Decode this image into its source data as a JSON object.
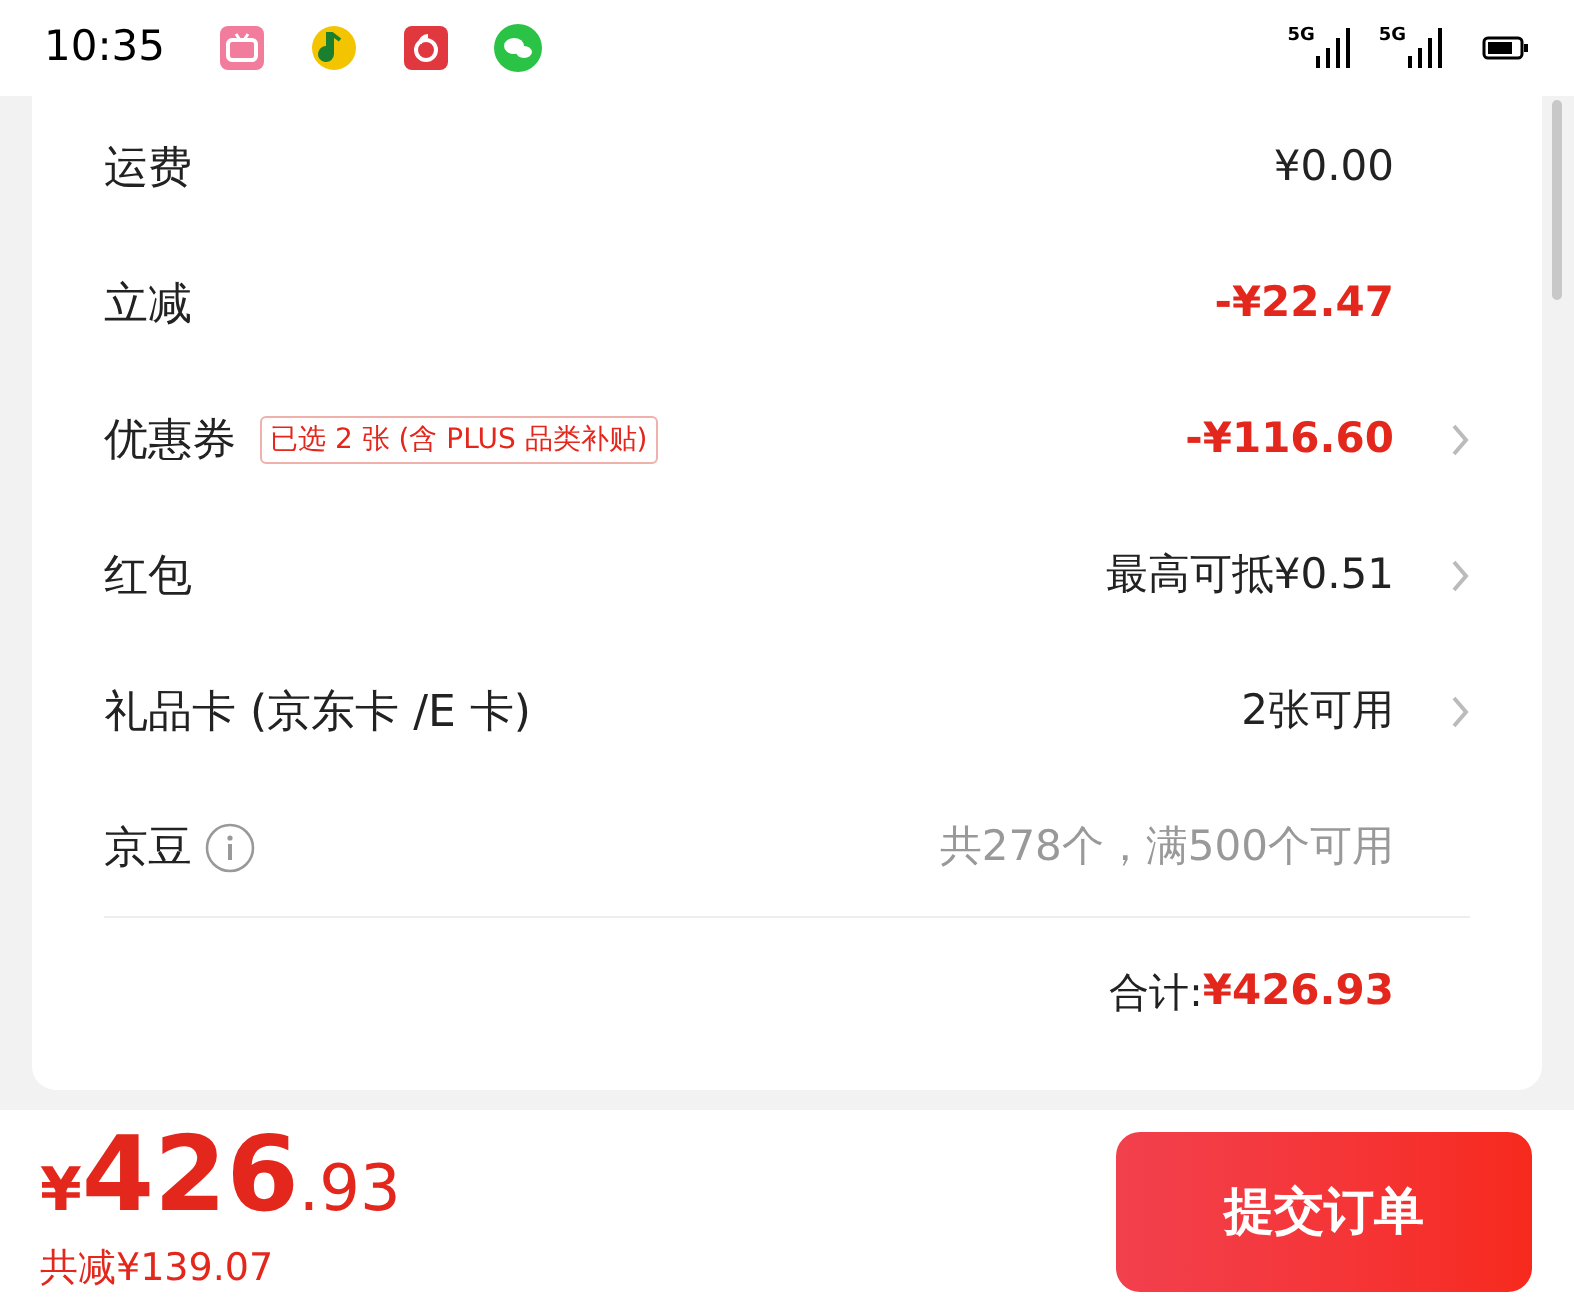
{
  "status_bar": {
    "time": "10:35",
    "network_labels": [
      "5G",
      "5G"
    ]
  },
  "rows": [
    {
      "label": "运费",
      "value": "¥0.00",
      "kind": "normal",
      "arrow": false
    },
    {
      "label": "立减",
      "value": "-¥22.47",
      "kind": "discount",
      "arrow": false
    },
    {
      "label": "优惠券",
      "tag": "已选 2 张 (含 PLUS 品类补贴)",
      "value": "-¥116.60",
      "kind": "discount",
      "arrow": true
    },
    {
      "label": "红包",
      "value": "最高可抵¥0.51",
      "kind": "normal",
      "arrow": true
    },
    {
      "label": "礼品卡 (京东卡 /E 卡)",
      "value": "2张可用",
      "kind": "normal",
      "arrow": true
    },
    {
      "label": "京豆",
      "info": true,
      "value": "共278个，满500个可用",
      "kind": "muted",
      "arrow": false
    }
  ],
  "total": {
    "label": "合计:",
    "value": "¥426.93"
  },
  "footer": {
    "currency": "¥",
    "integer": "426",
    "decimal": ".93",
    "savings": "共减¥139.07",
    "submit": "提交订单"
  }
}
